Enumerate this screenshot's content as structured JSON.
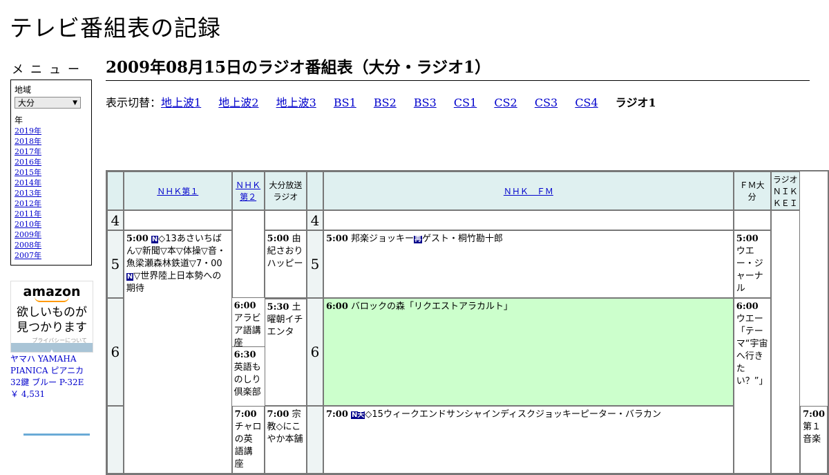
{
  "site_title": "テレビ番組表の記録",
  "menu": {
    "title": "メニュー",
    "region_label": "地域",
    "region_value": "大分",
    "year_label": "年",
    "years": [
      "2019年",
      "2018年",
      "2017年",
      "2016年",
      "2015年",
      "2014年",
      "2013年",
      "2012年",
      "2011年",
      "2010年",
      "2009年",
      "2008年",
      "2007年"
    ]
  },
  "ad": {
    "logo": "amazon",
    "line1": "欲しいものが",
    "line2": "見つかります",
    "privacy": "プライバシーについて",
    "product_title": "ヤマハ YAMAHA PIANICA ピアニカ 32鍵 ブルー P-32E",
    "product_price": "￥ 4,531"
  },
  "heading": "2009年08月15日のラジオ番組表（大分・ラジオ1）",
  "switcher": {
    "label": "表示切替：",
    "links": [
      "地上波1",
      "地上波2",
      "地上波3",
      "BS1",
      "BS2",
      "BS3",
      "CS1",
      "CS2",
      "CS3",
      "CS4"
    ],
    "current": "ラジオ1"
  },
  "channels": {
    "nhk1": "ＮＨＫ第１",
    "nhk2a": "ＮＨＫ",
    "nhk2b": "第２",
    "oita1": "大分放送",
    "oita2": "ラジオ",
    "nhkfm": "ＮＨＫ　ＦＭ",
    "fm1": "ＦＭ大",
    "fm2": "分",
    "nk1": "ラジオ",
    "nk2": "ＮＩＫ",
    "nk3": "ＫＥＩ"
  },
  "hours": [
    "4",
    "5",
    "6"
  ],
  "programs": {
    "nhk1_500_time": "5:00",
    "nhk1_500_badge": "N",
    "nhk1_500_a": "◇13あさいちばん▽新聞▽本▽体操▽音・魚梁瀬森林鉄道▽7・00",
    "nhk1_500_badge2": "N",
    "nhk1_500_b": "▽世界陸上日本勢への期待",
    "nhk2_600_time": "6:00",
    "nhk2_600_text": "アラビア語講座",
    "nhk2_630_time": "6:30",
    "nhk2_630_text": "英語ものしり倶楽部",
    "nhk2_700_time": "7:00",
    "nhk2_700_text": "チャロの英語講座",
    "oita_500_time": "5:00",
    "oita_500_text": "由紀さおりハッピー",
    "oita_530_time": "5:30",
    "oita_530_text": "土曜朝イチエンタ",
    "oita_700_time": "7:00",
    "oita_700_text": "宗教◇にこやか本舗",
    "fm_500_time": "5:00",
    "fm_500_text": "邦楽ジョッキー",
    "fm_500_badge": "再",
    "fm_500_text2": "ゲスト・桐竹勘十郎",
    "fm_600_time": "6:00",
    "fm_600_text": "バロックの森「リクエストアラカルト」",
    "fm_700_time": "7:00",
    "fm_700_badge": "N天",
    "fm_700_text": "◇15ウィークエンドサンシャインディスクジョッキーピーター・バラカン",
    "fmo_500_time": "5:00",
    "fmo_500_text": "ウエー・ジャーナル",
    "fmo_600_time": "6:00",
    "fmo_600_text": "ウエー「テーマ“宇宙へ行きたい？”」",
    "nk_700_time": "7:00",
    "nk_700_text": "第１音楽"
  }
}
